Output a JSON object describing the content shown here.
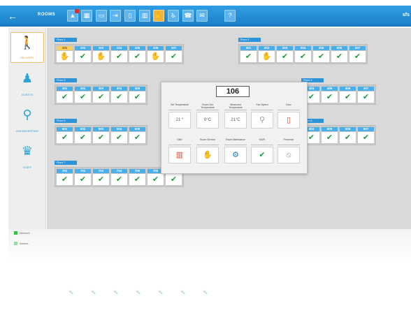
{
  "topbar": {
    "title": "ROOMS",
    "user": "sfs",
    "back_glyph": "←",
    "buttons": [
      {
        "icon": "alert-icon",
        "glyph": "▲",
        "active": false
      },
      {
        "icon": "grid-icon",
        "glyph": "▦",
        "active": false
      },
      {
        "icon": "monitor-icon",
        "glyph": "▭",
        "active": false
      },
      {
        "icon": "door-enter-icon",
        "glyph": "⇥",
        "active": false
      },
      {
        "icon": "door-icon",
        "glyph": "▯",
        "active": false
      },
      {
        "icon": "heater-icon",
        "glyph": "▥",
        "active": false
      },
      {
        "icon": "service-icon",
        "glyph": "✋",
        "active": true
      },
      {
        "icon": "cleaning-icon",
        "glyph": "♿",
        "active": false
      },
      {
        "icon": "phone-icon",
        "glyph": "☎",
        "active": false
      },
      {
        "icon": "message-icon",
        "glyph": "✉",
        "active": false
      },
      {
        "icon": "help-icon",
        "glyph": "?",
        "active": false
      }
    ]
  },
  "leftnav": {
    "items": [
      {
        "label": "DELIVERY",
        "icon": "delivery-icon",
        "glyph": "🚶",
        "active": true
      },
      {
        "label": "GUESTS",
        "icon": "guest-icon",
        "glyph": "♟",
        "active": false
      },
      {
        "label": "HOUSEKEEPING",
        "icon": "housekeeping-icon",
        "glyph": "⚲",
        "active": false
      },
      {
        "label": "STAFF",
        "icon": "staff-icon",
        "glyph": "♛",
        "active": false
      }
    ]
  },
  "floors": [
    {
      "label": "Floor 1",
      "rooms": [
        {
          "num": "101",
          "status": "service",
          "selected": true
        },
        {
          "num": "102",
          "status": "ok"
        },
        {
          "num": "103",
          "status": "service"
        },
        {
          "num": "104",
          "status": "ok"
        },
        {
          "num": "105",
          "status": "ok"
        },
        {
          "num": "106",
          "status": "service"
        },
        {
          "num": "107",
          "status": "ok"
        }
      ]
    },
    {
      "label": "Floor 2",
      "rooms": [
        {
          "num": "201",
          "status": "ok"
        },
        {
          "num": "202",
          "status": "service"
        },
        {
          "num": "203",
          "status": "ok"
        },
        {
          "num": "204",
          "status": "ok"
        },
        {
          "num": "205",
          "status": "ok"
        },
        {
          "num": "206",
          "status": "ok"
        },
        {
          "num": "207",
          "status": "ok"
        }
      ]
    },
    {
      "label": "Floor 3",
      "rooms": [
        {
          "num": "301",
          "status": "ok"
        },
        {
          "num": "302",
          "status": "ok"
        },
        {
          "num": "303",
          "status": "ok"
        },
        {
          "num": "304",
          "status": "ok"
        },
        {
          "num": "305",
          "status": "ok"
        }
      ]
    },
    {
      "label": "Floor 4",
      "rooms": [
        {
          "num": "404",
          "status": "ok"
        },
        {
          "num": "405",
          "status": "ok"
        },
        {
          "num": "406",
          "status": "ok"
        },
        {
          "num": "407",
          "status": "ok"
        }
      ]
    },
    {
      "label": "Floor 5",
      "rooms": [
        {
          "num": "501",
          "status": "ok"
        },
        {
          "num": "502",
          "status": "ok"
        },
        {
          "num": "503",
          "status": "ok"
        },
        {
          "num": "504",
          "status": "ok"
        },
        {
          "num": "505",
          "status": "ok"
        }
      ]
    },
    {
      "label": "Floor 6",
      "rooms": [
        {
          "num": "604",
          "status": "ok"
        },
        {
          "num": "605",
          "status": "ok"
        },
        {
          "num": "606",
          "status": "ok"
        },
        {
          "num": "607",
          "status": "ok"
        }
      ]
    },
    {
      "label": "Floor 7",
      "rooms": [
        {
          "num": "701",
          "status": "ok"
        },
        {
          "num": "702",
          "status": "ok"
        },
        {
          "num": "703",
          "status": "ok"
        },
        {
          "num": "704",
          "status": "ok"
        },
        {
          "num": "705",
          "status": "ok"
        },
        {
          "num": "706",
          "status": "ok"
        },
        {
          "num": "707",
          "status": "ok"
        }
      ]
    }
  ],
  "popup": {
    "room": "106",
    "row1": [
      {
        "label": "Set Temperature",
        "value": "21 °",
        "icon": "thermostat-stepper"
      },
      {
        "label": "Room Set Temperature",
        "value": "0°C",
        "icon": "temp-icon"
      },
      {
        "label": "Measured Temperature",
        "value": "21°C",
        "icon": "temp-icon"
      },
      {
        "label": "Fan Speed",
        "value": "⚲",
        "icon": "fan-icon"
      },
      {
        "label": "Door",
        "value": "▯",
        "icon": "door-icon"
      }
    ],
    "row2": [
      {
        "label": "DND",
        "value": "▥",
        "icon": "dnd-icon"
      },
      {
        "label": "Room Service",
        "value": "✋",
        "icon": "room-service-icon"
      },
      {
        "label": "Room Attendance",
        "value": "⚙",
        "icon": "attendance-icon"
      },
      {
        "label": "MUR",
        "value": "✔",
        "icon": "check-icon"
      },
      {
        "label": "Presence",
        "value": "⦸",
        "icon": "presence-icon"
      }
    ]
  },
  "bottom": {
    "legend": [
      {
        "label": "Network"
      },
      {
        "label": "Alarms"
      }
    ]
  },
  "colors": {
    "accent_blue": "#1b7fc9",
    "room_blue": "#4aaee8",
    "ok_green": "#1f9a3c",
    "selected_yellow": "#f6cf62",
    "door_red": "#e2422e"
  }
}
